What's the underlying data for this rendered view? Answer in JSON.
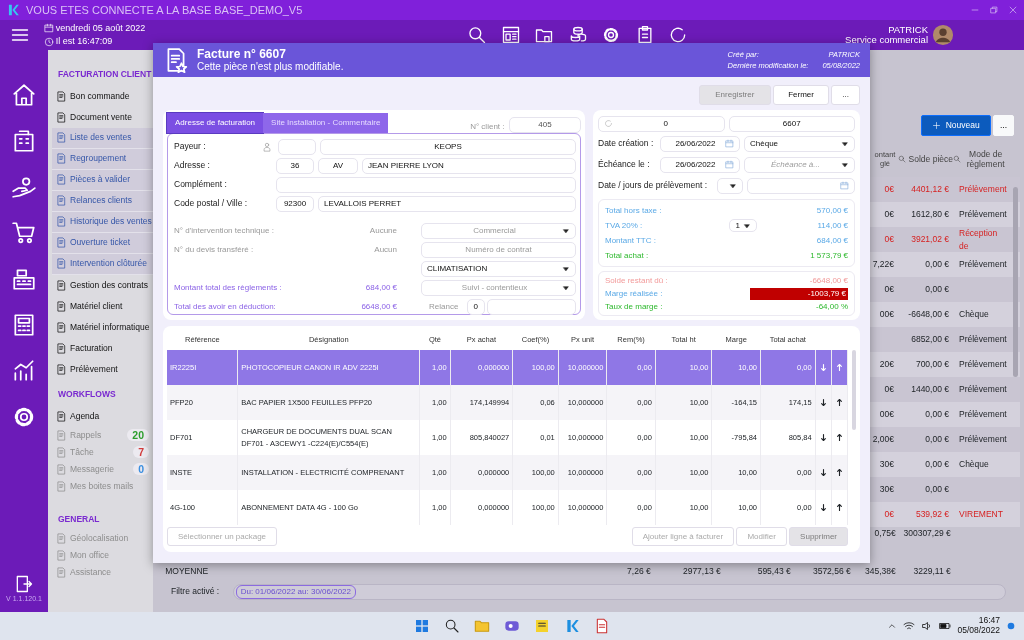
{
  "window": {
    "title": "VOUS ETES CONNECTE A LA BASE BASE_DEMO_V5"
  },
  "header": {
    "date": "vendredi 05 août 2022",
    "time": "Il est 16:47:09",
    "user": "PATRICK",
    "role": "Service commercial"
  },
  "rail": {
    "version": "V 1.1.120.1"
  },
  "sidebar": {
    "sections": [
      {
        "title": "FACTURATION CLIENT",
        "items": [
          {
            "label": "Bon commande",
            "kind": "main"
          },
          {
            "label": "Document vente",
            "kind": "main"
          },
          {
            "label": "Liste des ventes",
            "kind": "sub"
          },
          {
            "label": "Regroupement",
            "kind": "sub"
          },
          {
            "label": "Pièces à valider",
            "kind": "sub"
          },
          {
            "label": "Relances clients",
            "kind": "sub"
          },
          {
            "label": "Historique des ventes",
            "kind": "sub"
          },
          {
            "label": "Ouverture ticket",
            "kind": "sub"
          },
          {
            "label": "Intervention clôturée",
            "kind": "sub"
          },
          {
            "label": "Gestion des contrats",
            "kind": "main"
          },
          {
            "label": "Matériel client",
            "kind": "main"
          },
          {
            "label": "Matériel informatique",
            "kind": "main"
          },
          {
            "label": "Facturation",
            "kind": "main"
          },
          {
            "label": "Prélèvement",
            "kind": "main"
          }
        ]
      },
      {
        "title": "WORKFLOWS",
        "items": [
          {
            "label": "Agenda",
            "kind": "main"
          },
          {
            "label": "Rappels",
            "kind": "muted",
            "count": "20",
            "color": "#2e9e2e"
          },
          {
            "label": "Tâche",
            "kind": "muted",
            "count": "7",
            "color": "#d23b3b"
          },
          {
            "label": "Messagerie",
            "kind": "muted",
            "count": "0",
            "color": "#3b8fe0"
          },
          {
            "label": "Mes boites mails",
            "kind": "muted"
          }
        ]
      },
      {
        "title": "GENERAL",
        "items": [
          {
            "label": "Géolocalisation",
            "kind": "muted"
          },
          {
            "label": "Mon office",
            "kind": "muted"
          },
          {
            "label": "Assistance",
            "kind": "muted"
          }
        ]
      }
    ]
  },
  "list": {
    "new_button": "Nouveau",
    "more_button": "...",
    "columns": [
      "ontant glé",
      "Solde pièce",
      "Mode de règlement"
    ],
    "rows": [
      {
        "paid": "0€",
        "balance": "4401,12 €",
        "mode": "Prélèvement",
        "highlighted": true
      },
      {
        "paid": "0€",
        "balance": "1612,80 €",
        "mode": "Prélèvement",
        "highlighted": false
      },
      {
        "paid": "0€",
        "balance": "3921,02 €",
        "mode": "Réception de",
        "highlighted": true
      },
      {
        "paid": "7,22€",
        "balance": "0,00 €",
        "mode": "Prélèvement",
        "highlighted": false
      },
      {
        "paid": "0€",
        "balance": "0,00 €",
        "highlighted": false
      },
      {
        "paid": "00€",
        "balance": "-6648,00 €",
        "mode": "Chèque",
        "highlighted": false
      },
      {
        "balance": "6852,00 €",
        "mode": "Prélèvement",
        "highlighted": false
      },
      {
        "paid": "20€",
        "balance": "700,00 €",
        "mode": "Prélèvement",
        "highlighted": false
      },
      {
        "paid": "0€",
        "balance": "1440,00 €",
        "mode": "Prélèvement",
        "highlighted": false
      },
      {
        "paid": "00€",
        "balance": "0,00 €",
        "mode": "Prélèvement",
        "highlighted": false
      },
      {
        "paid": "2,00€",
        "balance": "0,00 €",
        "mode": "Prélèvement",
        "highlighted": false
      },
      {
        "paid": "30€",
        "balance": "0,00 €",
        "mode": "Chèque",
        "highlighted": false
      },
      {
        "paid": "30€",
        "balance": "0,00 €",
        "highlighted": false
      },
      {
        "paid": "0€",
        "balance": "539,92 €",
        "mode": "VIREMENT",
        "highlighted": true
      }
    ],
    "totals": [
      "0,75€",
      "300307,29 €"
    ],
    "average": {
      "label": "MOYENNE",
      "cells": [
        "7,26 €",
        "2977,13 €",
        "595,43 €",
        "3572,56 €",
        "345,38€",
        "3229,11 €"
      ]
    },
    "filter": {
      "label": "Filtre activé :",
      "value": "Du: 01/06/2022 au: 30/06/2022"
    }
  },
  "invoice": {
    "title": "Facture n° 6607",
    "subtitle": "Cette pièce n'est plus modifiable.",
    "meta": [
      {
        "label": "Créé par:",
        "value": "PATRICK"
      },
      {
        "label": "Dernière modification le:",
        "value": "05/08/2022"
      }
    ],
    "buttons": [
      {
        "label": "Enregistrer",
        "disabled": true
      },
      {
        "label": "Fermer",
        "disabled": false
      },
      {
        "label": "...",
        "disabled": false
      }
    ],
    "tabs": [
      {
        "label": "Adresse de facturation",
        "selected": true
      },
      {
        "label": "Site Installation - Commentaire",
        "selected": false
      }
    ],
    "client_no": {
      "label": "N° client :",
      "value": "405"
    },
    "payer": {
      "label": "Payeur :",
      "name": "KEOPS"
    },
    "street": {
      "label": "Adresse :",
      "number": "36",
      "type": "AV",
      "name": "JEAN PIERRE LYON"
    },
    "complement": {
      "label": "Complément :"
    },
    "city": {
      "label": "Code postal / Ville :",
      "postcode": "92300",
      "name": "LEVALLOIS PERRET"
    },
    "intervention": {
      "label": "N° d'intervention technique :",
      "value": "Aucune",
      "select": "Commercial"
    },
    "quote": {
      "label": "N° du devis transféré :",
      "value": "Aucun",
      "placeholder": "Numéro de contrat"
    },
    "category": {
      "select": "CLIMATISATION"
    },
    "payments": {
      "label": "Montant total des règlements :",
      "value": "684,00 €",
      "placeholder": "Suivi - contentieux"
    },
    "credits": {
      "label": "Total des avoir en déduction:",
      "value": "6648,00 €",
      "reminder_label": "Relance",
      "reminder": "0"
    },
    "counter": "0",
    "number": "6607",
    "created": {
      "label": "Date création :",
      "value": "26/06/2022"
    },
    "payment_mode": "Chèque",
    "due": {
      "label": "Échéance le :",
      "value": "26/06/2022",
      "placeholder": "Échéance à..."
    },
    "debit": {
      "label": "Date / jours de prélèvement :"
    },
    "totals": [
      {
        "label": "Total hors taxe :",
        "value": "570,00 €",
        "kind": "sales"
      },
      {
        "label": "TVA 20% :",
        "select": "1",
        "value": "114,00 €",
        "kind": "sales"
      },
      {
        "label": "Montant TTC :",
        "value": "684,00 €",
        "kind": "sales"
      },
      {
        "label": "Total achat :",
        "value": "1 573,79 €",
        "kind": "purchase"
      }
    ],
    "balance": [
      {
        "label": "Solde restant dû :",
        "value": "-6648,00 €",
        "kind": "due"
      },
      {
        "label": "Marge réalisée :",
        "value": "-1003,79 €",
        "kind": "alert"
      },
      {
        "label": "Taux de marge :",
        "value": "-64,00 %",
        "kind": "rate"
      }
    ],
    "lines": {
      "columns": [
        "Référence",
        "Désignation",
        "Qté",
        "Px achat",
        "Coef(%)",
        "Px unit",
        "Rem(%)",
        "Total ht",
        "Marge",
        "Total achat"
      ],
      "rows": [
        {
          "cells": [
            "IR2225I",
            "PHOTOCOPIEUR CANON IR ADV 2225I",
            "1,00",
            "0,000000",
            "100,00",
            "10,000000",
            "0,00",
            "10,00",
            "10,00",
            "0,00"
          ],
          "selected": true
        },
        {
          "cells": [
            "PFP20",
            "BAC PAPIER 1X500 FEUILLES PFP20",
            "1,00",
            "174,149994",
            "0,06",
            "10,000000",
            "0,00",
            "10,00",
            "-164,15",
            "174,15"
          ],
          "selected": false
        },
        {
          "cells": [
            "DF701",
            "CHARGEUR DE DOCUMENTS DUAL SCAN DF701 - A3CEWY1 -C224(E)/C554(E)",
            "1,00",
            "805,840027",
            "0,01",
            "10,000000",
            "0,00",
            "10,00",
            "-795,84",
            "805,84"
          ],
          "selected": false
        },
        {
          "cells": [
            "INSTE",
            "INSTALLATION - ELECTRICITÉ COMPRENANT",
            "1,00",
            "0,000000",
            "100,00",
            "10,000000",
            "0,00",
            "10,00",
            "10,00",
            "0,00"
          ],
          "selected": false
        },
        {
          "cells": [
            "4G-100",
            "ABONNEMENT DATA 4G - 100 Go",
            "1,00",
            "0,000000",
            "100,00",
            "10,000000",
            "0,00",
            "10,00",
            "10,00",
            "0,00"
          ],
          "selected": false
        }
      ]
    },
    "line_buttons": [
      {
        "label": "Sélectionner un package",
        "disabled": true
      },
      {
        "label": "Ajouter ligne à facturer",
        "disabled": true
      },
      {
        "label": "Modifier",
        "disabled": true
      },
      {
        "label": "Supprimer",
        "disabled": true
      }
    ]
  },
  "taskbar": {
    "time": "16:47",
    "date": "05/08/2022"
  }
}
